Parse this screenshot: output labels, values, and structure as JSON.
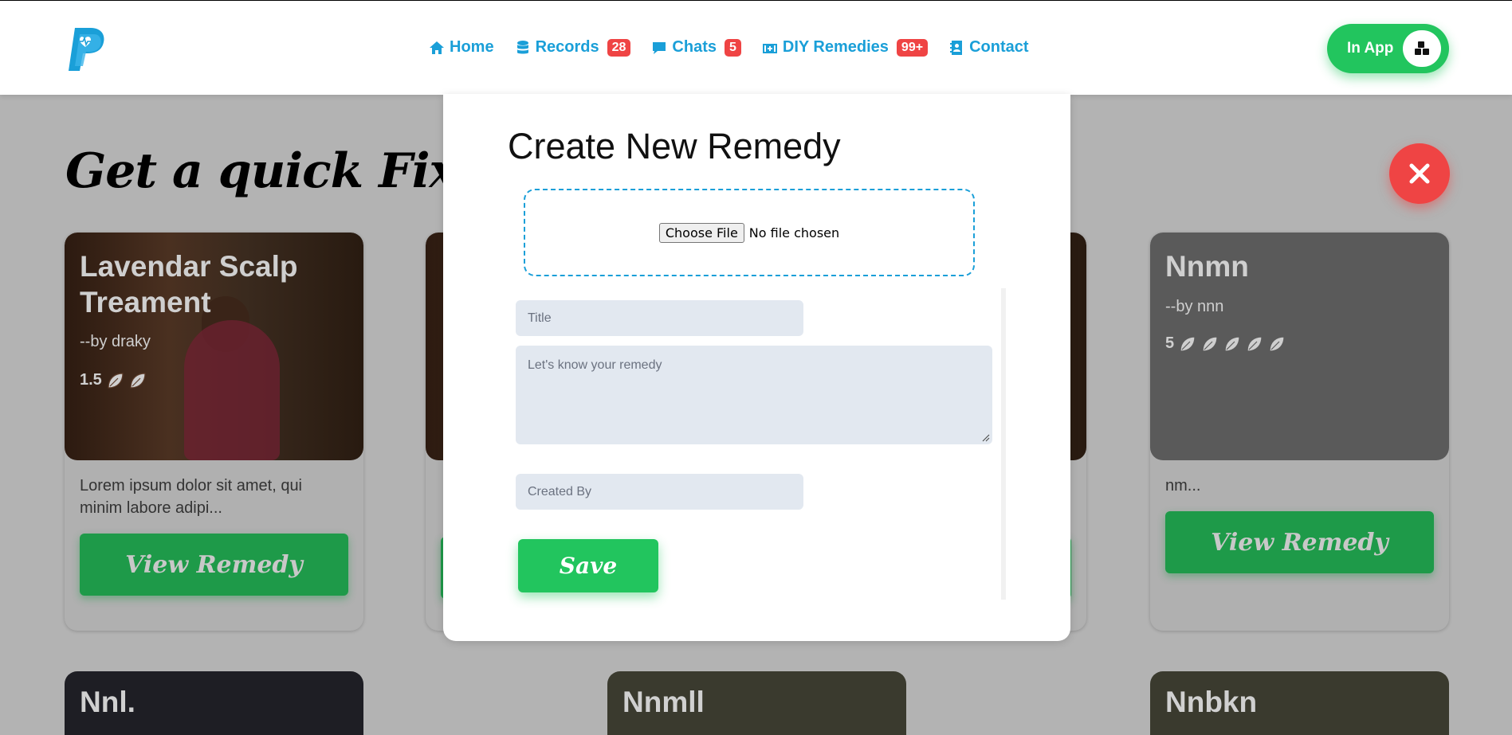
{
  "nav": {
    "home": "Home",
    "records": "Records",
    "records_badge": "28",
    "chats": "Chats",
    "chats_badge": "5",
    "diy": "DIY Remedies",
    "diy_badge": "99+",
    "contact": "Contact"
  },
  "in_app": {
    "label": "In App"
  },
  "page": {
    "title": "Get a quick Fix!"
  },
  "cards": [
    {
      "title": "Lavendar Scalp Treament",
      "author": "--by draky",
      "rating": "1.5",
      "description": "Lorem ipsum dolor sit amet, qui minim labore adipi...",
      "button": "View Remedy"
    },
    {
      "title": "Nnmn",
      "author": "--by nnn",
      "rating": "5",
      "description": "nm...",
      "button": "View Remedy"
    }
  ],
  "bottom_cards": [
    {
      "title": "Nnl."
    },
    {
      "title": "Nnmll"
    },
    {
      "title": "Nnbkn"
    }
  ],
  "modal": {
    "title": "Create New Remedy",
    "file_button": "Choose File",
    "file_status": "No file chosen",
    "title_placeholder": "Title",
    "remedy_placeholder": "Let's know your remedy",
    "created_by_placeholder": "Created By",
    "save": "Save"
  },
  "colors": {
    "brand_blue": "#1a9fd8",
    "accent_green": "#22c55e",
    "badge_red": "#ef4444"
  }
}
